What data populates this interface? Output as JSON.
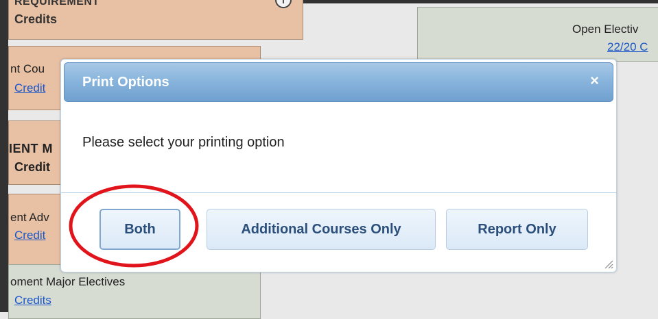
{
  "background": {
    "requirement_top": {
      "header": "REQUIREMENT",
      "credits": "Credits"
    },
    "block2": {
      "title": "nt Cou",
      "credits_link": "Credit"
    },
    "block3": {
      "title": "IENT M",
      "credits": "Credit"
    },
    "block4": {
      "title": "ent Adv",
      "credits_link": "Credit"
    },
    "block5": {
      "title": "oment Major Electives",
      "credits_link": "Credits"
    },
    "block6": {
      "title": "Open Electiv",
      "credits_link": "22/20 C"
    }
  },
  "dialog": {
    "title": "Print Options",
    "close_symbol": "×",
    "message": "Please select your printing option",
    "buttons": {
      "both": "Both",
      "additional": "Additional Courses Only",
      "report": "Report Only"
    }
  },
  "colors": {
    "accent_title": "#89b5dd",
    "button_text": "#2b4f7a",
    "annotation": "#e0141a"
  }
}
